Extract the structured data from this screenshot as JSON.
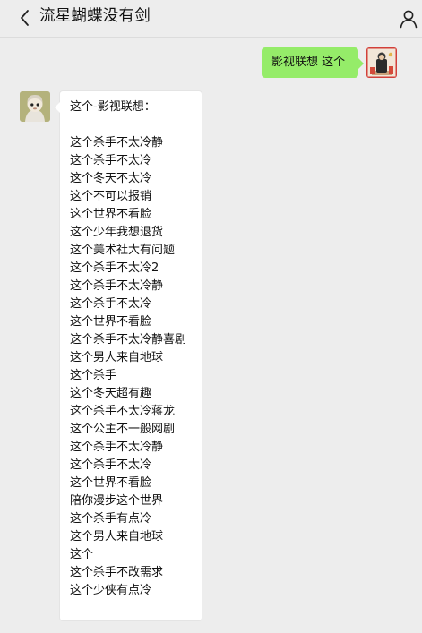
{
  "header": {
    "title": "流星蝴蝶没有剑"
  },
  "messages": {
    "outgoing": {
      "text": "影视联想 这个"
    },
    "incoming": {
      "heading": "这个-影视联想：",
      "lines": [
        "这个杀手不太冷静",
        "这个杀手不太冷",
        "这个冬天不太冷",
        "这个不可以报销",
        "这个世界不看脸",
        "这个少年我想退货",
        "这个美术社大有问题",
        "这个杀手不太冷2",
        "这个杀手不太冷静",
        "这个杀手不太冷",
        "这个世界不看脸",
        "这个杀手不太冷静喜剧",
        "这个男人来自地球",
        "这个杀手",
        "这个冬天超有趣",
        "这个杀手不太冷蒋龙",
        "这个公主不一般网剧",
        "这个杀手不太冷静",
        "这个杀手不太冷",
        "这个世界不看脸",
        "陪你漫步这个世界",
        "这个杀手有点冷",
        "这个男人来自地球",
        "这个",
        "这个杀手不改需求",
        "这个少侠有点冷"
      ]
    }
  },
  "colors": {
    "background": "#ededed",
    "outgoing_bubble": "#95ec69",
    "incoming_bubble": "#ffffff"
  },
  "icons": {
    "back": "chevron-left-icon",
    "profile": "person-icon"
  }
}
